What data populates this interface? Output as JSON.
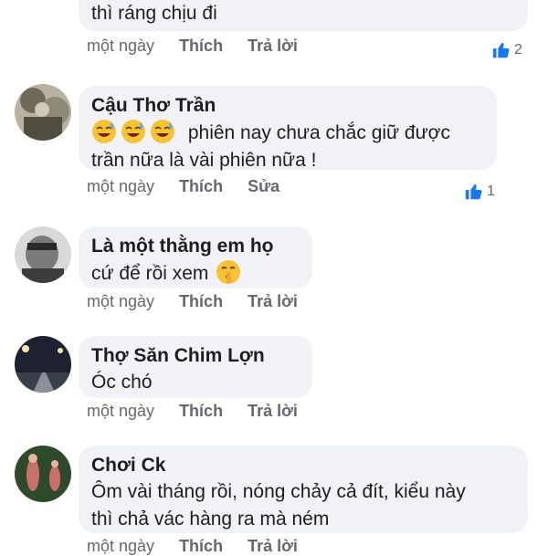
{
  "comments": [
    {
      "author": "",
      "text": "thì ráng chịu đi",
      "time": "một ngày",
      "action1": "Thích",
      "action2": "Trả lời",
      "like_count": "2"
    },
    {
      "author": "Cậu Thơ Trần",
      "text_line1": "phiên nay chưa chắc giữ được",
      "text_line2": "trần nữa là vài phiên nữa !",
      "time": "một ngày",
      "action1": "Thích",
      "action2": "Sửa",
      "like_count": "1"
    },
    {
      "author": "Là một thằng em họ",
      "text": "cứ để rồi xem",
      "time": "một ngày",
      "action1": "Thích",
      "action2": "Trả lời"
    },
    {
      "author": "Thợ Săn Chim Lợn",
      "text": "Óc chó",
      "time": "một ngày",
      "action1": "Thích",
      "action2": "Trả lời"
    },
    {
      "author": "Chơi Ck",
      "text_line1": "Ôm vài tháng rồi, nóng chảy cả đít, kiểu này",
      "text_line2": "thì chả vác hàng ra mà ném",
      "time": "một ngày",
      "action1": "Thích",
      "action2": "Trả lời"
    }
  ],
  "colors": {
    "bubble": "#f0f2f5",
    "meta_text": "#65676b",
    "like_blue": "#1877f2"
  },
  "icons": [
    "like-icon",
    "sweat-smile-emoji",
    "shushing-emoji"
  ]
}
